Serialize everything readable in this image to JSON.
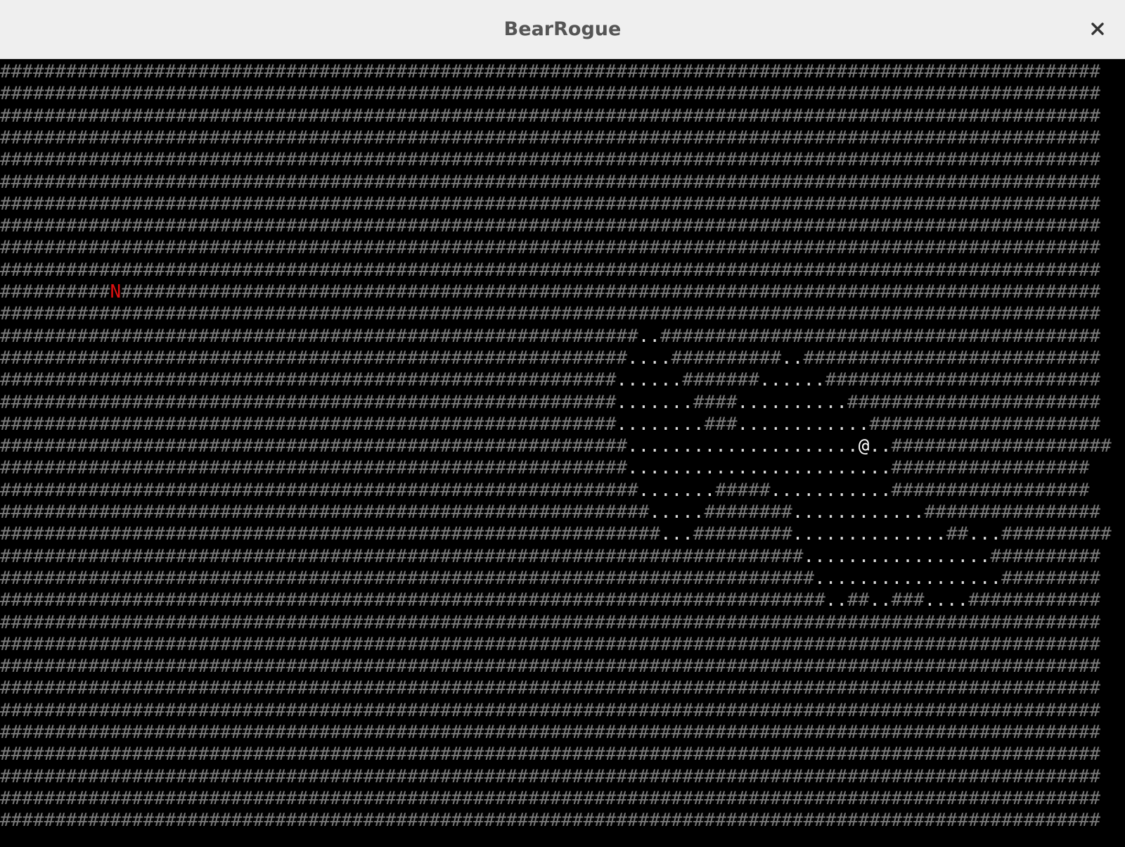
{
  "window": {
    "title": "BearRogue",
    "close_glyph": "×"
  },
  "colors": {
    "wall": "#7a7a7a",
    "floor": "#dcdcdc",
    "player": "#ffffff",
    "monster": "#dd1111",
    "background": "#000000"
  },
  "map": {
    "rows": [
      "####################################################################################################",
      "####################################################################################################",
      "####################################################################################################",
      "####################################################################################################",
      "####################################################################################################",
      "####################################################################################################",
      "####################################################################################################",
      "####################################################################################################",
      "####################################################################################################",
      "####################################################################################################",
      "##########N#########################################################################################",
      "####################################################################################################",
      "##########################################################..########################################",
      "#########################################################....##########..###########################",
      "########################################################......#######......#########################",
      "########################################################.......####..........#######################",
      "########################################################........###............#####################",
      "#########################################################.....................@..####################",
      "#########################################################........................##################",
      "##########################################################.......#####...........##################",
      "###########################################################.....########............################",
      "############################################################...#########..............##...##########",
      "#########################################################################.................##########",
      "##########################################################################.................#########",
      "###########################################################################..##..###....############",
      "####################################################################################################",
      "####################################################################################################",
      "####################################################################################################",
      "####################################################################################################",
      "####################################################################################################",
      "####################################################################################################",
      "####################################################################################################",
      "####################################################################################################",
      "####################################################################################################",
      "####################################################################################################"
    ]
  }
}
